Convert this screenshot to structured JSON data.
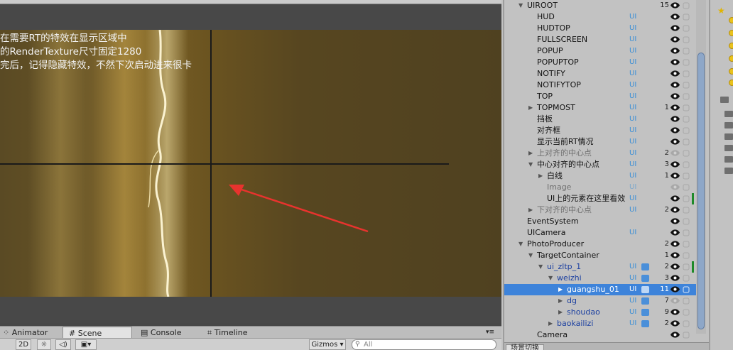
{
  "scene": {
    "overlay_lines": [
      "在需要RT的特效在显示区域中",
      "的RenderTexture尺寸固定1280",
      "完后，记得隐藏特效，不然下次启动进来很卡"
    ]
  },
  "tabs": {
    "animator": "Animator",
    "scene": "Scene",
    "console": "Console",
    "timeline": "Timeline"
  },
  "toolbar": {
    "mode_2d": "2D",
    "gizmos": "Gizmos ▾",
    "search_placeholder": "All"
  },
  "hierarchy": {
    "rows": [
      {
        "name": "UIROOT",
        "count": "15"
      },
      {
        "name": "HUD",
        "tag": "UI"
      },
      {
        "name": "HUDTOP",
        "tag": "UI"
      },
      {
        "name": "FULLSCREEN",
        "tag": "UI"
      },
      {
        "name": "POPUP",
        "tag": "UI"
      },
      {
        "name": "POPUPTOP",
        "tag": "UI"
      },
      {
        "name": "NOTIFY",
        "tag": "UI"
      },
      {
        "name": "NOTIFYTOP",
        "tag": "UI"
      },
      {
        "name": "TOP",
        "tag": "UI"
      },
      {
        "name": "TOPMOST",
        "tag": "UI",
        "count": "1"
      },
      {
        "name": "挡板",
        "tag": "UI"
      },
      {
        "name": "对齐框",
        "tag": "UI"
      },
      {
        "name": "显示当前RT情况",
        "tag": "UI"
      },
      {
        "name": "上对齐的中心点",
        "tag": "UI",
        "count": "2"
      },
      {
        "name": "中心对齐的中心点",
        "tag": "UI",
        "count": "3"
      },
      {
        "name": "白线",
        "tag": "UI",
        "count": "1"
      },
      {
        "name": "Image",
        "tag": "UI"
      },
      {
        "name": "UI上的元素在这里看效",
        "tag": "UI"
      },
      {
        "name": "下对齐的中心点",
        "tag": "UI",
        "count": "2"
      },
      {
        "name": "EventSystem"
      },
      {
        "name": "UICamera",
        "tag": "UI"
      },
      {
        "name": "PhotoProducer",
        "count": "2"
      },
      {
        "name": "TargetContainer",
        "count": "1"
      },
      {
        "name": "ui_zltp_1",
        "tag": "UI",
        "count": "2"
      },
      {
        "name": "weizhi",
        "tag": "UI",
        "count": "3"
      },
      {
        "name": "guangshu_01",
        "tag": "UI",
        "count": "11"
      },
      {
        "name": "dg",
        "tag": "UI",
        "count": "7"
      },
      {
        "name": "shoudao",
        "tag": "UI",
        "count": "9"
      },
      {
        "name": "baokailizi",
        "tag": "UI",
        "count": "2"
      },
      {
        "name": "Camera"
      }
    ],
    "bottom_tab": "场景切换"
  }
}
